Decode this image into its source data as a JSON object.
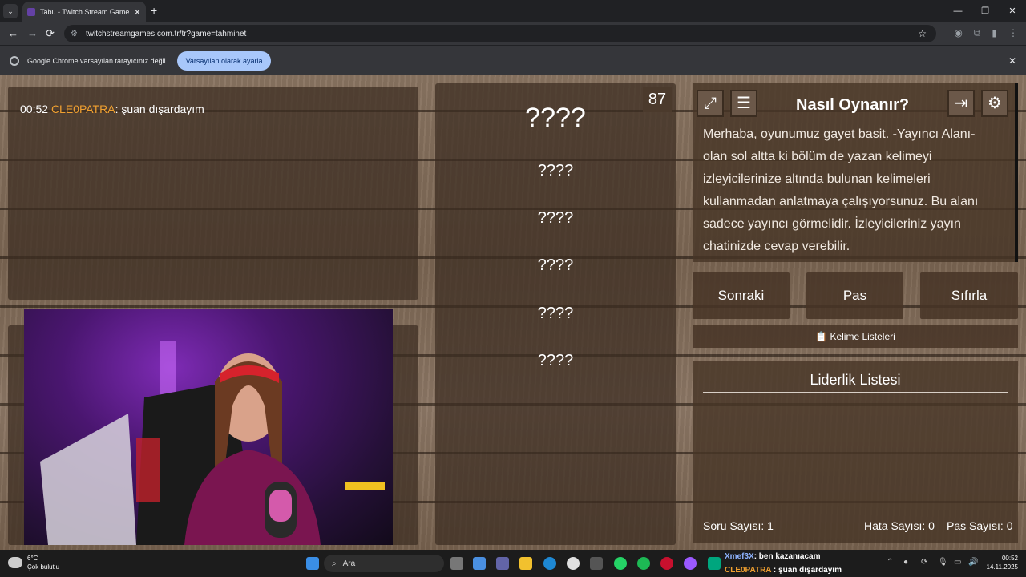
{
  "browser": {
    "tab_title": "Tabu - Twitch Stream Game",
    "url": "twitchstreamgames.com.tr/tr?game=tahminet",
    "infobar_text": "Google Chrome varsayılan tarayıcınız değil",
    "infobar_button": "Varsayılan olarak ayarla",
    "icons": {
      "back": "←",
      "forward": "→",
      "reload": "⟳",
      "star": "☆",
      "tab_close": "✕",
      "new_tab": "+",
      "minimize": "—",
      "maximize": "❐",
      "close": "✕",
      "infobar_close": "✕"
    }
  },
  "chat": {
    "time": "00:52",
    "user": "CLE0PATRA",
    "separator": ":",
    "message": "şuan dışardayım"
  },
  "game": {
    "counter": "87",
    "main_word": "????",
    "hidden_words": [
      "????",
      "????",
      "????",
      "????",
      "????"
    ]
  },
  "info": {
    "title": "Nasıl Oynanır?",
    "text": "Merhaba, oyunumuz gayet basit. -Yayıncı Alanı- olan sol altta ki bölüm de yazan kelimeyi izleyicilerinize altında bulunan kelimeleri kullanmadan anlatmaya çalışıyorsunuz. Bu alanı sadece yayıncı görmelidir. İzleyicileriniz yayın chatinizde cevap verebilir."
  },
  "actions": {
    "next": "Sonraki",
    "pass": "Pas",
    "reset": "Sıfırla",
    "word_lists": "📋 Kelime Listeleri"
  },
  "leaderboard": {
    "title": "Liderlik Listesi",
    "question_count": "Soru Sayısı: 1",
    "error_count": "Hata Sayısı: 0",
    "pass_count": "Pas Sayısı: 0"
  },
  "taskbar": {
    "temp": "6°C",
    "weather": "Çok bulutlu",
    "search": "Ara",
    "chat_line1_user": "Xmef3X",
    "chat_line1_msg": ": ben kazanıacam",
    "chat_line2_user": "CLE0PATRA",
    "chat_line2_msg": " : şuan dışardayım",
    "time": "00:52",
    "date": "14.11.2025"
  }
}
